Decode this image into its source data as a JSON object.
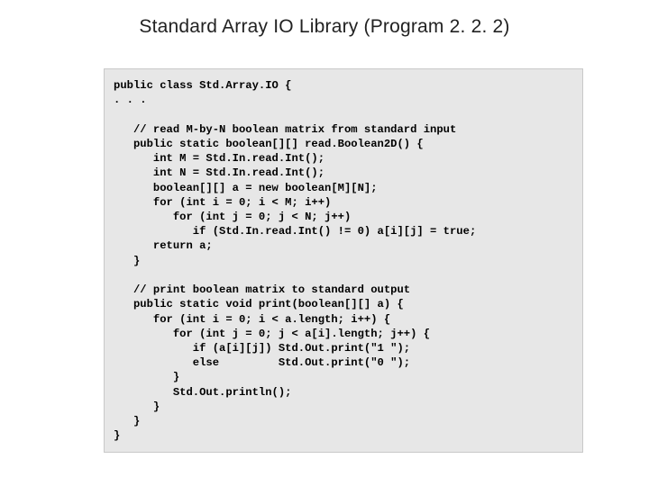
{
  "title": "Standard Array IO Library (Program 2. 2. 2)",
  "code": {
    "l01": "public class Std.Array.IO {",
    "l02": ". . .",
    "l03": "   // read M-by-N boolean matrix from standard input",
    "l04": "   public static boolean[][] read.Boolean2D() {",
    "l05": "      int M = Std.In.read.Int();",
    "l06": "      int N = Std.In.read.Int();",
    "l07": "      boolean[][] a = new boolean[M][N];",
    "l08": "      for (int i = 0; i < M; i++)",
    "l09": "         for (int j = 0; j < N; j++)",
    "l10": "            if (Std.In.read.Int() != 0) a[i][j] = true;",
    "l11": "      return a;",
    "l12": "   }",
    "l13": "",
    "l14": "   // print boolean matrix to standard output",
    "l15": "   public static void print(boolean[][] a) {",
    "l16": "      for (int i = 0; i < a.length; i++) {",
    "l17": "         for (int j = 0; j < a[i].length; j++) {",
    "l18": "            if (a[i][j]) Std.Out.print(\"1 \");",
    "l19": "            else         Std.Out.print(\"0 \");",
    "l20": "         }",
    "l21": "         Std.Out.println();",
    "l22": "      }",
    "l23": "   }",
    "l24": "}"
  }
}
